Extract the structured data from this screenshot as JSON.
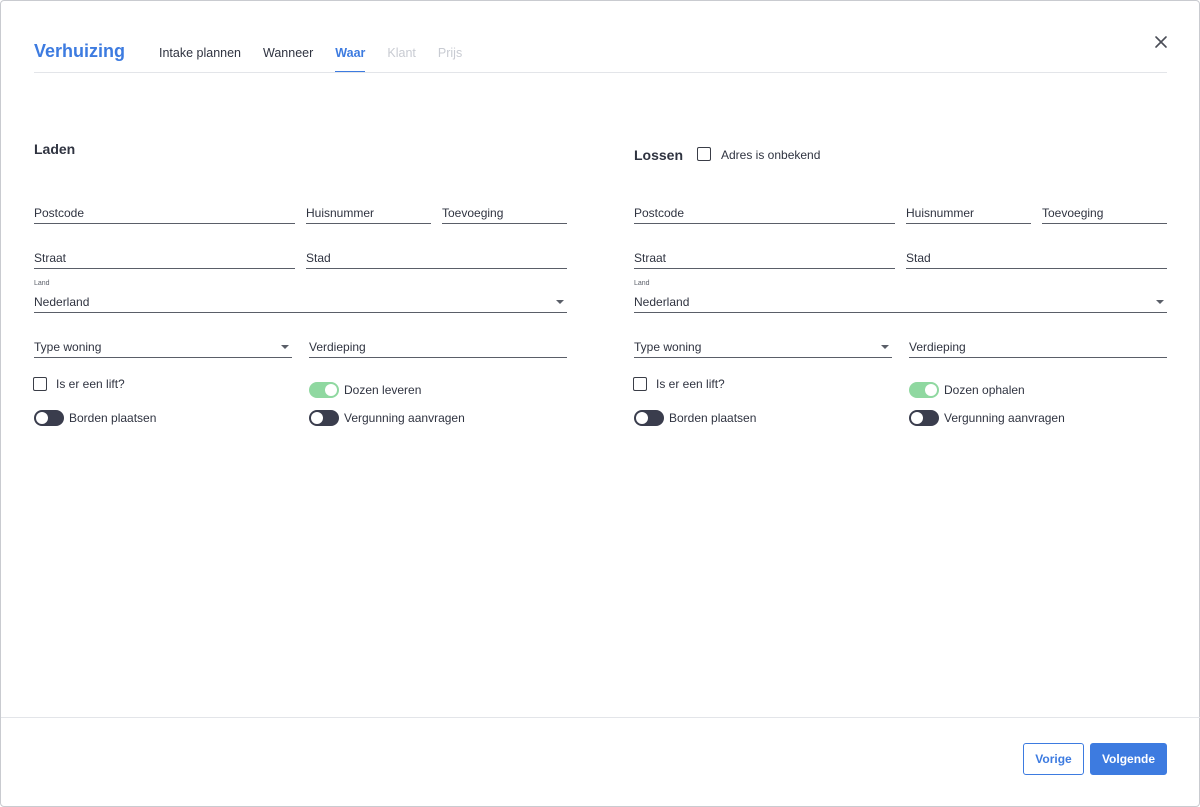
{
  "header": {
    "title": "Verhuizing",
    "tabs": [
      {
        "label": "Intake plannen"
      },
      {
        "label": "Wanneer"
      },
      {
        "label": "Waar"
      },
      {
        "label": "Klant"
      },
      {
        "label": "Prijs"
      }
    ],
    "active_tab": "Waar"
  },
  "laden": {
    "title": "Laden",
    "postcode": "Postcode",
    "huisnummer": "Huisnummer",
    "toevoeging": "Toevoeging",
    "straat": "Straat",
    "stad": "Stad",
    "land_label": "Land",
    "land": "Nederland",
    "type_woning": "Type woning",
    "verdieping": "Verdieping",
    "lift_label": "Is er een lift?",
    "dozen_label": "Dozen leveren",
    "borden_label": "Borden plaatsen",
    "vergunning_label": "Vergunning aanvragen"
  },
  "lossen": {
    "title": "Lossen",
    "adres_onbekend": "Adres is onbekend",
    "postcode": "Postcode",
    "huisnummer": "Huisnummer",
    "toevoeging": "Toevoeging",
    "straat": "Straat",
    "stad": "Stad",
    "land_label": "Land",
    "land": "Nederland",
    "type_woning": "Type woning",
    "verdieping": "Verdieping",
    "lift_label": "Is er een lift?",
    "dozen_label": "Dozen ophalen",
    "borden_label": "Borden plaatsen",
    "vergunning_label": "Vergunning aanvragen"
  },
  "footer": {
    "prev_label": "Vorige",
    "next_label": "Volgende"
  },
  "colors": {
    "accent": "#3d7be0",
    "toggle_on": "#8fd8a0",
    "toggle_off": "#3a3d4d"
  }
}
